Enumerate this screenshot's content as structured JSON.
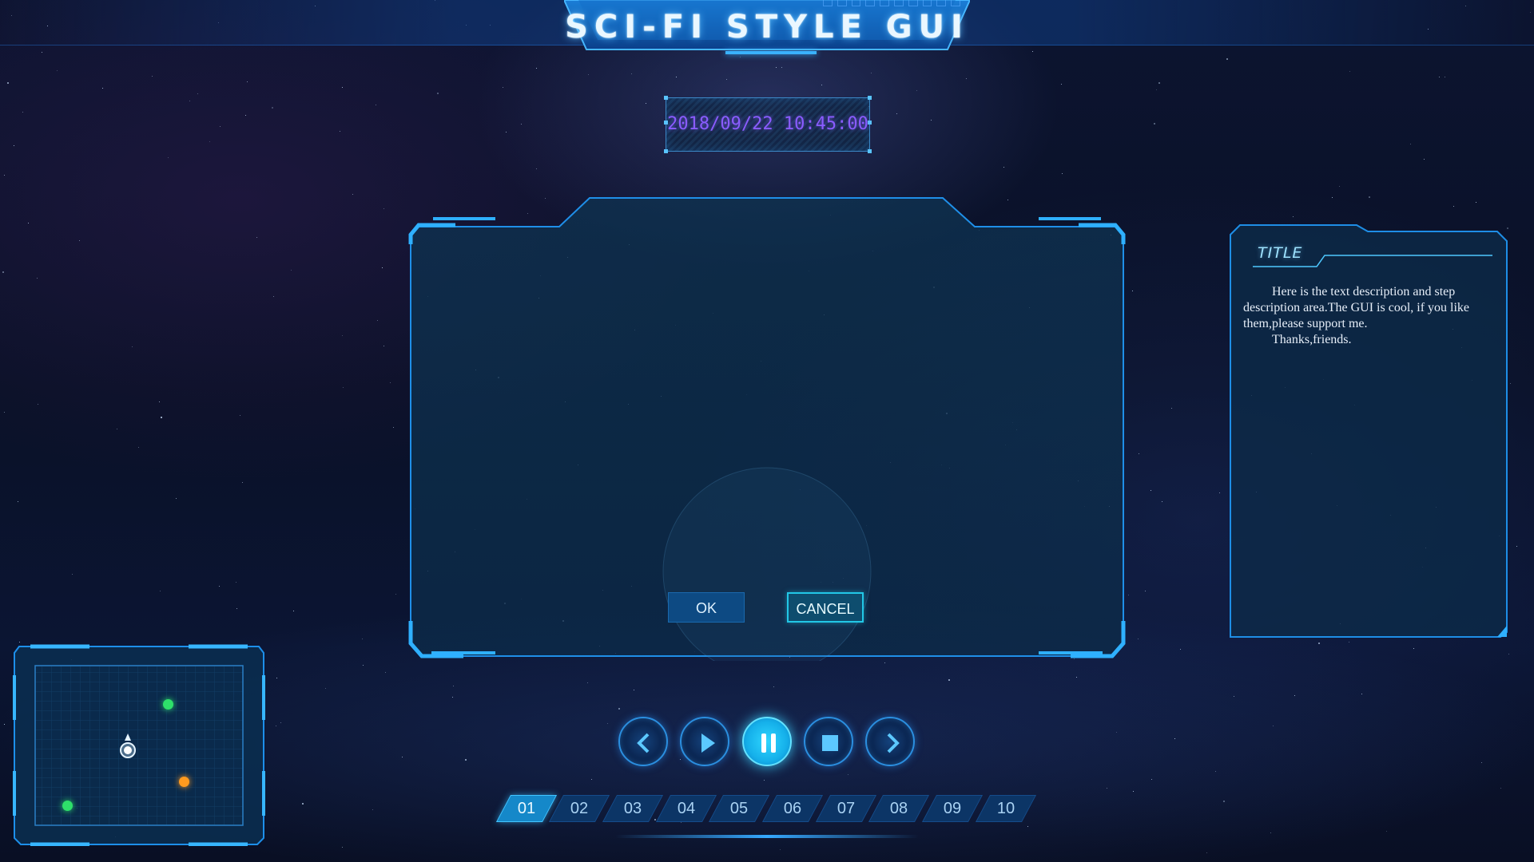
{
  "header": {
    "title": "SCI-FI STYLE GUI"
  },
  "datetime": "2018/09/22 10:45:00",
  "dialog": {
    "ok_label": "OK",
    "cancel_label": "CANCEL"
  },
  "panel": {
    "title": "TITLE",
    "paragraphs": [
      "Here is the text description and step description area.The GUI is cool, if you like them,please support me.",
      "Thanks,friends."
    ]
  },
  "media_controls": [
    {
      "name": "previous-button",
      "icon": "chevron-left-icon"
    },
    {
      "name": "play-button",
      "icon": "play-icon"
    },
    {
      "name": "pause-button",
      "icon": "pause-icon",
      "active": true
    },
    {
      "name": "stop-button",
      "icon": "stop-icon"
    },
    {
      "name": "next-button",
      "icon": "chevron-right-icon"
    }
  ],
  "pages": {
    "items": [
      "01",
      "02",
      "03",
      "04",
      "05",
      "06",
      "07",
      "08",
      "09",
      "10"
    ],
    "active": "01"
  },
  "minimap": {
    "markers": [
      {
        "name": "marker-green-1",
        "color": "#2ee06a"
      },
      {
        "name": "marker-green-2",
        "color": "#2ee06a"
      },
      {
        "name": "marker-orange",
        "color": "#ff9a1f"
      },
      {
        "name": "player-marker",
        "color": "#ffffff"
      }
    ]
  },
  "colors": {
    "accent": "#2d9cff",
    "active": "#23c8ff",
    "date_text": "#8a5cff"
  }
}
